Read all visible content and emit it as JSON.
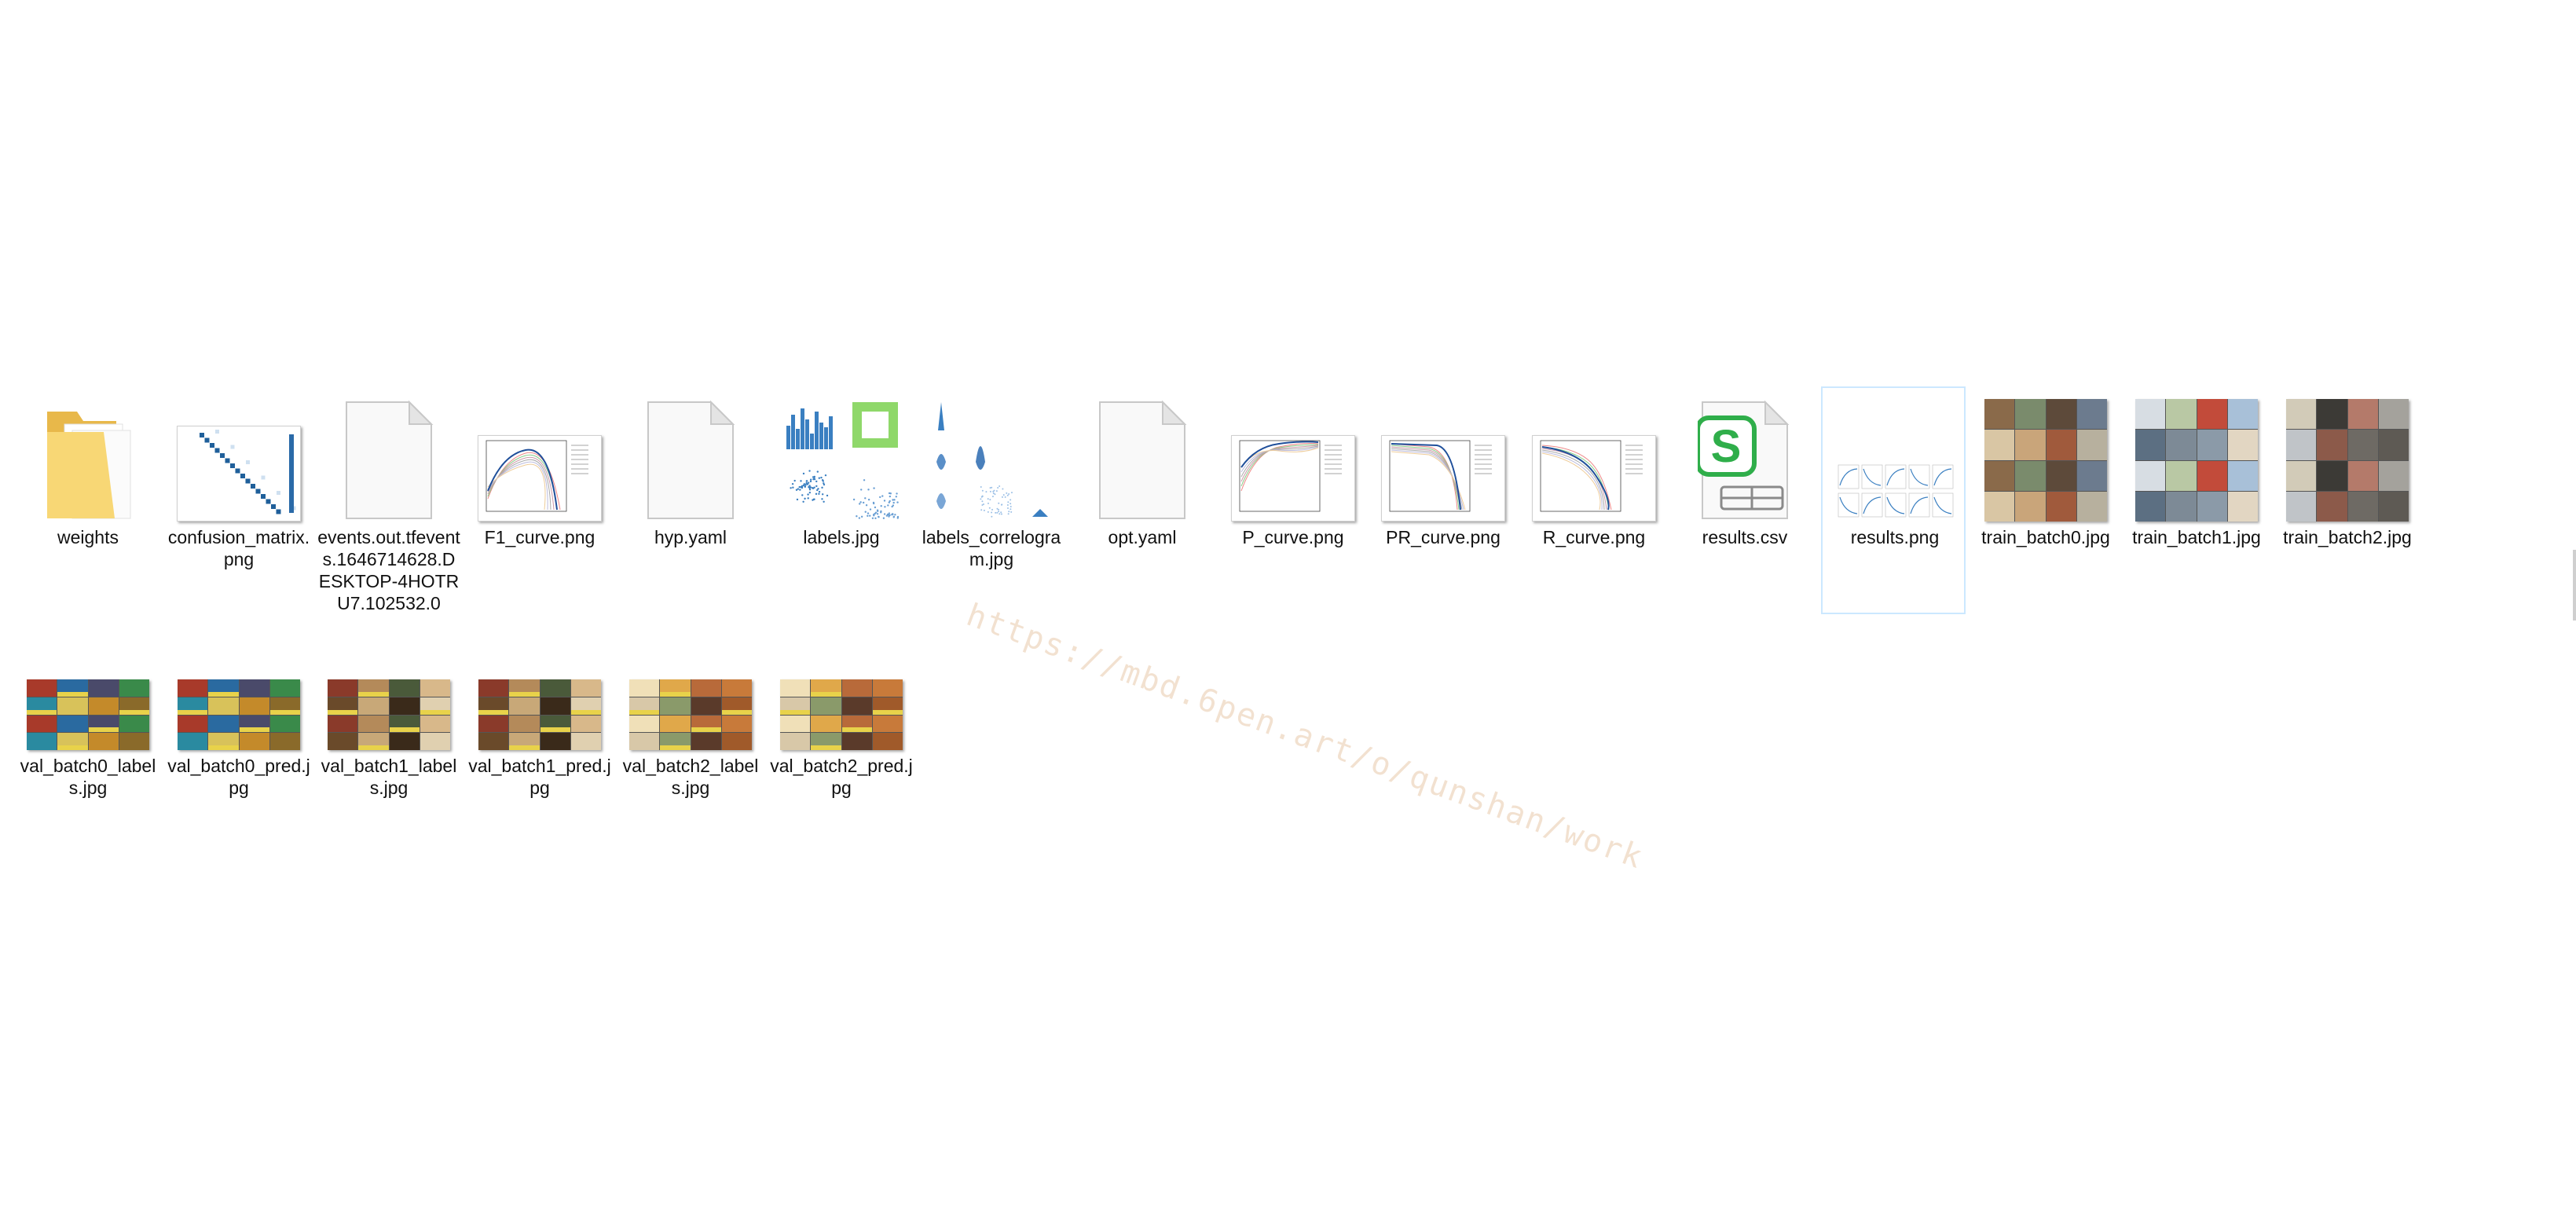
{
  "files": [
    {
      "name": "weights",
      "kind": "folder",
      "icon": "folder-icon",
      "selected": false
    },
    {
      "name": "confusion_matrix.png",
      "kind": "confusion",
      "icon": "confusion-matrix-thumbnail",
      "selected": false
    },
    {
      "name": "events.out.tfevents.1646714628.DESKTOP-4HOTRU7.102532.0",
      "kind": "blank",
      "icon": "blank-file-icon",
      "selected": false
    },
    {
      "name": "F1_curve.png",
      "kind": "curve",
      "icon": "f1-curve-thumbnail",
      "curve": "f1",
      "selected": false
    },
    {
      "name": "hyp.yaml",
      "kind": "blank",
      "icon": "blank-file-icon",
      "selected": false
    },
    {
      "name": "labels.jpg",
      "kind": "labels",
      "icon": "labels-thumbnail",
      "selected": false
    },
    {
      "name": "labels_correlogram.jpg",
      "kind": "correlogram",
      "icon": "correlogram-thumbnail",
      "selected": false
    },
    {
      "name": "opt.yaml",
      "kind": "blank",
      "icon": "blank-file-icon",
      "selected": false
    },
    {
      "name": "P_curve.png",
      "kind": "curve",
      "icon": "p-curve-thumbnail",
      "curve": "p",
      "selected": false
    },
    {
      "name": "PR_curve.png",
      "kind": "curve",
      "icon": "pr-curve-thumbnail",
      "curve": "pr",
      "selected": false
    },
    {
      "name": "R_curve.png",
      "kind": "curve",
      "icon": "r-curve-thumbnail",
      "curve": "r",
      "selected": false
    },
    {
      "name": "results.csv",
      "kind": "csv",
      "icon": "spreadsheet-file-icon",
      "selected": false
    },
    {
      "name": "results.png",
      "kind": "results",
      "icon": "results-thumbnail",
      "selected": true
    },
    {
      "name": "train_batch0.jpg",
      "kind": "mosaic-sq",
      "icon": "train-batch0-thumbnail",
      "palette": 0,
      "selected": false
    },
    {
      "name": "train_batch1.jpg",
      "kind": "mosaic-sq",
      "icon": "train-batch1-thumbnail",
      "palette": 1,
      "selected": false
    },
    {
      "name": "train_batch2.jpg",
      "kind": "mosaic-sq",
      "icon": "train-batch2-thumbnail",
      "palette": 2,
      "selected": false
    },
    {
      "name": "val_batch0_labels.jpg",
      "kind": "mosaic-wide",
      "icon": "val-batch0-labels-thumbnail",
      "palette": 3,
      "selected": false
    },
    {
      "name": "val_batch0_pred.jpg",
      "kind": "mosaic-wide",
      "icon": "val-batch0-pred-thumbnail",
      "palette": 3,
      "selected": false
    },
    {
      "name": "val_batch1_labels.jpg",
      "kind": "mosaic-wide",
      "icon": "val-batch1-labels-thumbnail",
      "palette": 4,
      "selected": false
    },
    {
      "name": "val_batch1_pred.jpg",
      "kind": "mosaic-wide",
      "icon": "val-batch1-pred-thumbnail",
      "palette": 4,
      "selected": false
    },
    {
      "name": "val_batch2_labels.jpg",
      "kind": "mosaic-wide",
      "icon": "val-batch2-labels-thumbnail",
      "palette": 5,
      "selected": false
    },
    {
      "name": "val_batch2_pred.jpg",
      "kind": "mosaic-wide",
      "icon": "val-batch2-pred-thumbnail",
      "palette": 5,
      "selected": false
    }
  ],
  "colors": {
    "selection_border": "#cce8ff",
    "folder": "#f8d775",
    "folder_dark": "#e8b84a",
    "chart_blue": "#3a7fc1",
    "csv_green": "#2fae4a"
  },
  "watermark": "https://mbd.6pen.art/o/qunshan/work"
}
